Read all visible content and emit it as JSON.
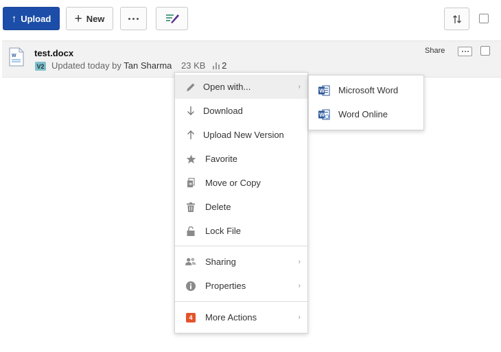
{
  "toolbar": {
    "upload_label": "Upload",
    "new_label": "New",
    "icons": {
      "upload": "arrow-up-icon",
      "new": "plus-icon",
      "more": "ellipsis-icon",
      "sign": "signature-icon",
      "sort": "sort-icon"
    }
  },
  "file": {
    "name": "test.docx",
    "version_badge": "V2",
    "updated_text": "Updated today by",
    "owner": "Tan Sharma",
    "size": "23 KB",
    "views": "2",
    "share_label": "Share",
    "icon": "word-document-icon"
  },
  "context_menu": {
    "items": [
      {
        "label": "Open with...",
        "icon": "pencil-icon",
        "submenu": true
      },
      {
        "label": "Download",
        "icon": "arrow-down-icon",
        "submenu": false
      },
      {
        "label": "Upload New Version",
        "icon": "arrow-up-icon",
        "submenu": false
      },
      {
        "label": "Favorite",
        "icon": "star-icon",
        "submenu": false
      },
      {
        "label": "Move or Copy",
        "icon": "move-copy-icon",
        "submenu": false
      },
      {
        "label": "Delete",
        "icon": "trash-icon",
        "submenu": false
      },
      {
        "label": "Lock File",
        "icon": "lock-icon",
        "submenu": false
      },
      {
        "label": "Sharing",
        "icon": "people-icon",
        "submenu": true
      },
      {
        "label": "Properties",
        "icon": "info-icon",
        "submenu": true
      },
      {
        "label": "More Actions",
        "icon": "apps-badge-icon",
        "badge": "4",
        "submenu": true
      }
    ]
  },
  "open_with_submenu": {
    "items": [
      {
        "label": "Microsoft Word",
        "icon": "word-icon"
      },
      {
        "label": "Word Online",
        "icon": "word-online-icon"
      }
    ]
  },
  "colors": {
    "primary": "#1c4da8",
    "row_background": "#f2f2f2",
    "menu_hover": "#eeeeee",
    "badge_orange": "#e2542a",
    "version_badge": "#7fbfc8",
    "word_blue": "#2b579a"
  }
}
